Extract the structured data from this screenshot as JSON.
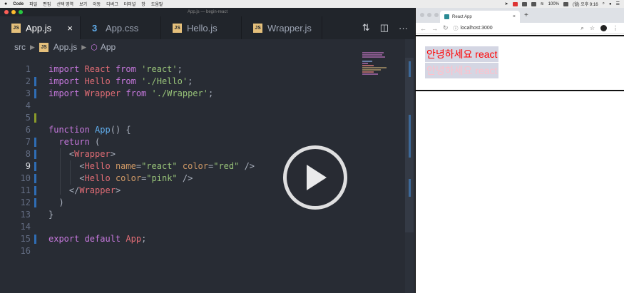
{
  "menubar": {
    "apple": "",
    "items": [
      "Code",
      "파일",
      "편집",
      "선택 영역",
      "보기",
      "이동",
      "디버그",
      "터미널",
      "창",
      "도움말"
    ],
    "battery": "100%",
    "clock": "(월) 오후 9:16"
  },
  "editor": {
    "window_title": "App.js — begin-react",
    "tabs": [
      {
        "label": "App.js",
        "icon": "js"
      },
      {
        "label": "App.css",
        "icon": "css"
      },
      {
        "label": "Hello.js",
        "icon": "js"
      },
      {
        "label": "Wrapper.js",
        "icon": "js"
      }
    ],
    "close_glyph": "×",
    "breadcrumb": {
      "folder": "src",
      "file": "App.js",
      "symbol": "App"
    },
    "lines": [
      [
        {
          "t": "import ",
          "c": "kw"
        },
        {
          "t": "React ",
          "c": "tag"
        },
        {
          "t": "from ",
          "c": "kw"
        },
        {
          "t": "'react'",
          "c": "str"
        },
        {
          "t": ";",
          "c": ""
        }
      ],
      [
        {
          "t": "import ",
          "c": "kw"
        },
        {
          "t": "Hello ",
          "c": "tag"
        },
        {
          "t": "from ",
          "c": "kw"
        },
        {
          "t": "'./Hello'",
          "c": "str"
        },
        {
          "t": ";",
          "c": ""
        }
      ],
      [
        {
          "t": "import ",
          "c": "kw"
        },
        {
          "t": "Wrapper ",
          "c": "tag"
        },
        {
          "t": "from ",
          "c": "kw"
        },
        {
          "t": "'./Wrapper'",
          "c": "str"
        },
        {
          "t": ";",
          "c": ""
        }
      ],
      [],
      [],
      [
        {
          "t": "function ",
          "c": "kw"
        },
        {
          "t": "App",
          "c": "fn"
        },
        {
          "t": "() {",
          "c": ""
        }
      ],
      [
        {
          "t": "  return ",
          "c": "kw"
        },
        {
          "t": "(",
          "c": ""
        }
      ],
      [
        {
          "t": "    <",
          "c": ""
        },
        {
          "t": "Wrapper",
          "c": "tag"
        },
        {
          "t": ">",
          "c": ""
        }
      ],
      [
        {
          "t": "      <",
          "c": ""
        },
        {
          "t": "Hello ",
          "c": "tag"
        },
        {
          "t": "name",
          "c": "attr"
        },
        {
          "t": "=",
          "c": ""
        },
        {
          "t": "\"react\" ",
          "c": "str"
        },
        {
          "t": "color",
          "c": "attr"
        },
        {
          "t": "=",
          "c": ""
        },
        {
          "t": "\"red\"",
          "c": "str"
        },
        {
          "t": " />",
          "c": ""
        }
      ],
      [
        {
          "t": "      <",
          "c": ""
        },
        {
          "t": "Hello ",
          "c": "tag"
        },
        {
          "t": "color",
          "c": "attr"
        },
        {
          "t": "=",
          "c": ""
        },
        {
          "t": "\"pink\"",
          "c": "str"
        },
        {
          "t": " />",
          "c": ""
        }
      ],
      [
        {
          "t": "    </",
          "c": ""
        },
        {
          "t": "Wrapper",
          "c": "tag"
        },
        {
          "t": ">",
          "c": ""
        }
      ],
      [
        {
          "t": "  )",
          "c": ""
        }
      ],
      [
        {
          "t": "}",
          "c": ""
        }
      ],
      [],
      [
        {
          "t": "export ",
          "c": "kw"
        },
        {
          "t": "default ",
          "c": "kw"
        },
        {
          "t": "App",
          "c": "tag"
        },
        {
          "t": ";",
          "c": ""
        }
      ],
      []
    ],
    "current_line": 9,
    "gutter_marks": {
      "2": "#2f6db5",
      "3": "#2f6db5",
      "5": "#8a9a2a",
      "7": "#2f6db5",
      "8": "#2f6db5",
      "9": "#2f6db5",
      "10": "#2f6db5",
      "11": "#2f6db5",
      "12": "#2f6db5",
      "15": "#2f6db5"
    }
  },
  "browser": {
    "tab_title": "React App",
    "tab_close": "×",
    "new_tab": "+",
    "url": "localhost:3000",
    "hello_lines": [
      {
        "text": "안녕하세요 react",
        "color": "#ff0000"
      },
      {
        "text": "안녕하세요 react",
        "color": "#ffc0cb"
      }
    ]
  },
  "colors": {
    "accent": "#e5c07b",
    "bg": "#282c34"
  }
}
